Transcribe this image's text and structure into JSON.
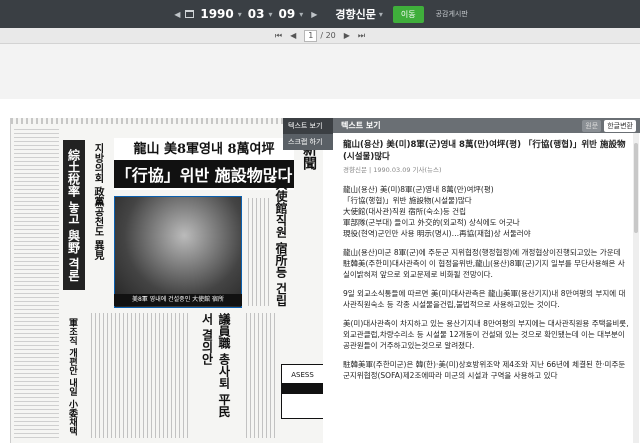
{
  "topbar": {
    "date": {
      "year": "1990",
      "month": "03",
      "day": "09"
    },
    "paper_name": "경향신문",
    "go_label": "이동",
    "notice_label": "공감게시판"
  },
  "pager": {
    "current": "1",
    "total": "/ 20"
  },
  "tooltip": {
    "item1": "텍스트 보기",
    "item2": "스크랩 하기"
  },
  "newspaper": {
    "main_head_line1": "龍山 美8軍영내 8萬여坪",
    "main_head_line2": "「行協」위반 施設物많다",
    "left_head": "綜土稅率 놓고 與野 격론",
    "left_sub1": "지방의회 政黨공천도 異見",
    "right_head1": "大使館직원 宿所등 건립",
    "right_head2": "議員職 총사퇴 平民서 결의안",
    "masthead": "鄕新聞",
    "caption": "美8軍 영내에 건설중인 大使館 宿所",
    "mid_text": "軍조직 개편안 내일 小委채택",
    "ad_text": "ASESS"
  },
  "panel": {
    "header": "텍스트 보기",
    "tab_original": "원문",
    "tab_hanja": "한글변환",
    "title": "龍山(용산) 美(미)8軍(군)영내 8萬(만)여坪(평) 「行協(행협)」위반 施設物(시설물)많다",
    "meta": "경향신문 | 1990.03.09 기사(뉴스)",
    "lines": [
      "龍山(용산) 美(미)8軍(군)영내 8萬(만)여坪(평)",
      "「行協(행협)」위반 施設物(시설물)많다",
      "大使館(대사관)직원 宿所(숙소)등 건립",
      "軍部隊(군부대) 들이고 外交的(외교적) 상식에도 어긋나",
      "現役(현역)군인만 사용 明示(명시)…再協(재협)상 서둘러야"
    ],
    "para1": "龍山(용산)미군 8軍(군)에 주둔군 지위협정(행정협정)에 개정협상이진행되고있는 가운데 駐韓美(주한미)대사관측이 이 협정을위반,龍山(용산)8軍(군)기지 일부를 무단사용해온 사실이밝혀져 앞으로 외교문제로 비화될 전망이다.",
    "para2": "9일 외교소식통들에 따르면 美(미)대사관측은 龍山美軍(용산기지)내 8만여평의 부지에 대사관직원숙소 등 각종 시설물을건립,불법적으로 사용하고있는 것이다.",
    "para3": "美(미)대사관측이 차지하고 있는 용산기지내 8만여평의 부지에는 대사관직원용 주택을비롯,외교관클럽,차량수리소 등 시설물 12개동이 건설돼 있는 것으로 확인됐는데 이는 대부분이 공관원들이 거주하고있는것으로 알려졌다.",
    "para4": "駐韓美軍(주한미군)은 韓(한)·美(미)상호방위조약 제4조와 지난 66년에 체결된 한·미주둔군지위협정(SOFA)제2조에따라 미군의 시설과 구역을 사용하고 있다"
  }
}
